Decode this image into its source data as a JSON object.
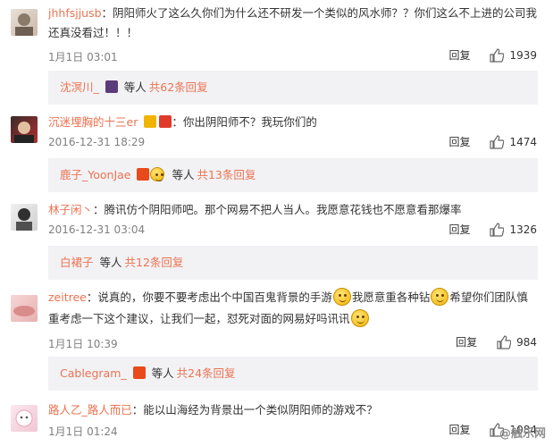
{
  "reply_label": "回复",
  "comments": [
    {
      "username": "jhhfsjjusb",
      "text_line1": "：阴阳师火了这么久你们为什么还不研发一个类似的风水师？？你们这么不上进的公司我",
      "text_line2": "还真没看过！！！",
      "time": "1月1日 03:01",
      "likes": "1939",
      "reply_user": "沈溟川_",
      "reply_etc": "等人",
      "reply_more": "共62条回复"
    },
    {
      "username": "沉迷埋胸的十三er",
      "text_line1": "：你出阴阳师不？我玩你们的",
      "time": "2016-12-31 18:29",
      "likes": "1474",
      "reply_user": "鹿子_YoonJae",
      "reply_etc": "等人",
      "reply_more": "共13条回复"
    },
    {
      "username": "林子闲丶",
      "text_line1": "：腾讯仿个阴阳师吧。那个网易不把人当人。我愿意花钱也不愿意看那爆率",
      "time": "2016-12-31 03:04",
      "likes": "1326",
      "reply_user": "白裙子",
      "reply_etc": "等人",
      "reply_more": "共12条回复"
    },
    {
      "username": "zeitree",
      "text_a": "：说真的，你要不要考虑出个中国百鬼背景的手游",
      "text_b": "我愿意重各种钻",
      "text_c": "希望你们团队慎",
      "text_line2": "重考虑一下这个建议，让我们一起，怼死对面的网易好吗讯讯",
      "time": "1月1日 10:39",
      "likes": "984",
      "reply_user": "Cablegram_",
      "reply_etc": "等人",
      "reply_more": "共24条回复"
    },
    {
      "username": "路人乙_路人而已",
      "text_line1": "：能以山海经为背景出一个类似阴阳师的游戏不？",
      "time": "1月1日 01:24",
      "likes": "1084"
    }
  ],
  "watermark": "@触乐网",
  "colors": {
    "link": "#eb7350",
    "reply_bg": "#f2f2f5",
    "meta": "#808080"
  }
}
